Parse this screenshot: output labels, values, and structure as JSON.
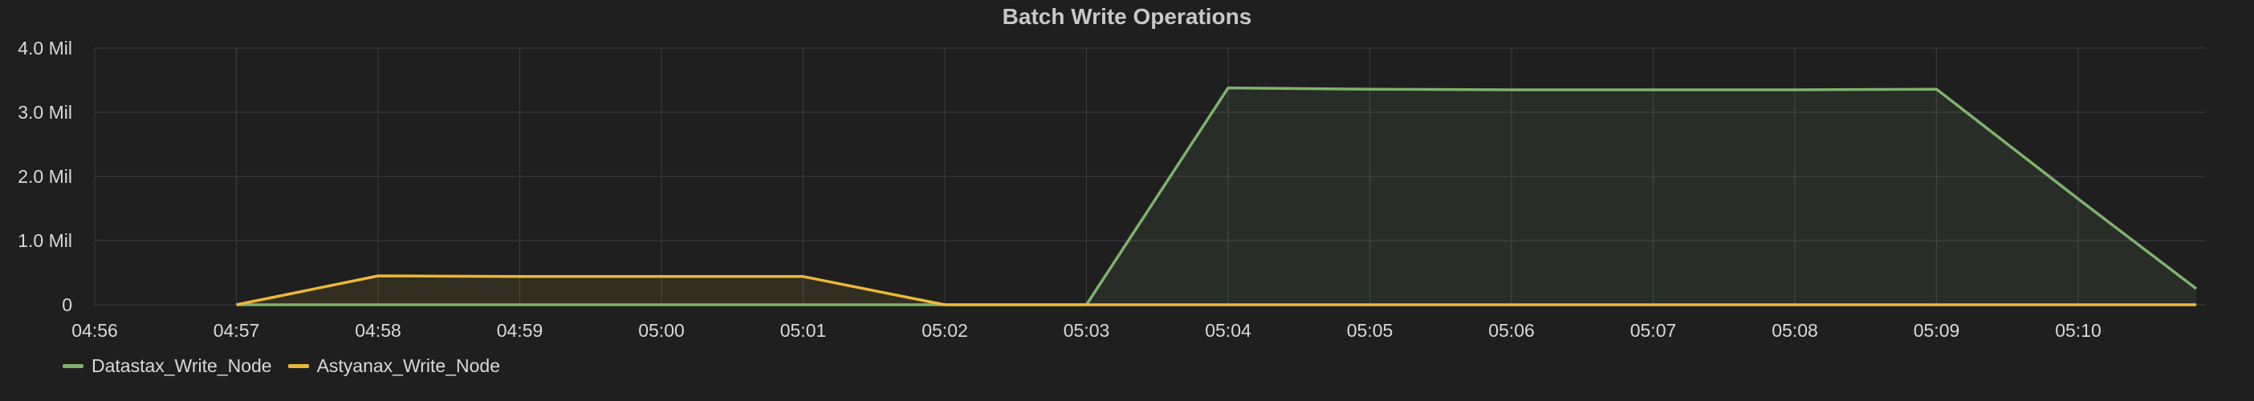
{
  "chart_data": {
    "type": "area",
    "title": "Batch Write Operations",
    "xlabel": "",
    "ylabel": "",
    "x": [
      "04:57",
      "04:58",
      "04:59",
      "05:00",
      "05:01",
      "05:02",
      "05:03",
      "05:04",
      "05:05",
      "05:06",
      "05:07",
      "05:08",
      "05:09",
      "05:10",
      "05:10:50"
    ],
    "x_ticks": [
      "04:56",
      "04:57",
      "04:58",
      "04:59",
      "05:00",
      "05:01",
      "05:02",
      "05:03",
      "05:04",
      "05:05",
      "05:06",
      "05:07",
      "05:08",
      "05:09",
      "05:10"
    ],
    "ylim": [
      0,
      4000000
    ],
    "y_ticks": [
      0,
      1000000,
      2000000,
      3000000,
      4000000
    ],
    "y_tick_labels": [
      "0",
      "1.0 Mil",
      "2.0 Mil",
      "3.0 Mil",
      "4.0 Mil"
    ],
    "grid": true,
    "legend": "bottom-left",
    "series": [
      {
        "name": "Datastax_Write_Node",
        "color": "#7eb26d",
        "values": [
          0,
          0,
          0,
          0,
          0,
          0,
          0,
          3380000,
          3360000,
          3350000,
          3350000,
          3350000,
          3360000,
          1650000,
          250000
        ]
      },
      {
        "name": "Astyanax_Write_Node",
        "color": "#eab839",
        "values": [
          0,
          450000,
          440000,
          440000,
          440000,
          0,
          0,
          0,
          0,
          0,
          0,
          0,
          0,
          0,
          0
        ]
      }
    ]
  }
}
